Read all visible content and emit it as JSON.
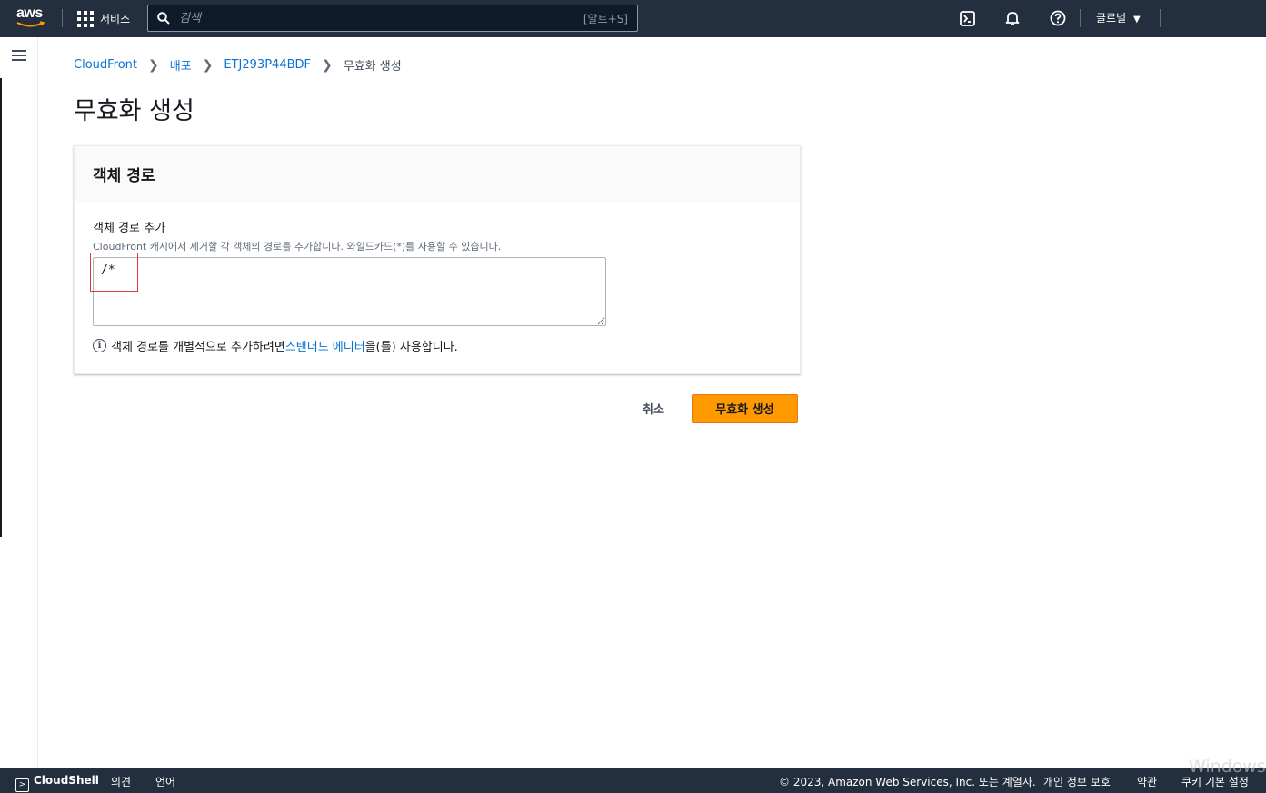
{
  "topnav": {
    "logo_text": "aws",
    "services_label": "서비스",
    "search_placeholder": "검색",
    "search_shortcut": "[알트+S]",
    "region_label": "글로벌"
  },
  "breadcrumb": {
    "items": [
      "CloudFront",
      "배포",
      "ETJ293P44BDF"
    ],
    "current": "무효화 생성"
  },
  "page": {
    "title": "무효화 생성"
  },
  "panel": {
    "title": "객체 경로",
    "field_label": "객체 경로 추가",
    "field_description": "CloudFront 캐시에서 제거할 각 객체의 경로를 추가합니다. 와일드카드(*)를 사용할 수 있습니다.",
    "field_value": "/*",
    "info_prefix": "객체 경로를 개별적으로 추가하려면 ",
    "info_link": "스탠더드 에디터",
    "info_suffix": "을(를) 사용합니다."
  },
  "actions": {
    "cancel_label": "취소",
    "submit_label": "무효화 생성"
  },
  "footer": {
    "cloudshell": "CloudShell",
    "feedback": "의견",
    "language": "언어",
    "copyright": "© 2023, Amazon Web Services, Inc. 또는 계열사.",
    "privacy": "개인 정보 보호",
    "terms": "약관",
    "cookies": "쿠키 기본 설정"
  },
  "watermark": "Windows",
  "colors": {
    "nav_bg": "#232f3e",
    "link": "#0972d3",
    "primary_button": "#ff9900",
    "highlight": "#e0383b"
  }
}
